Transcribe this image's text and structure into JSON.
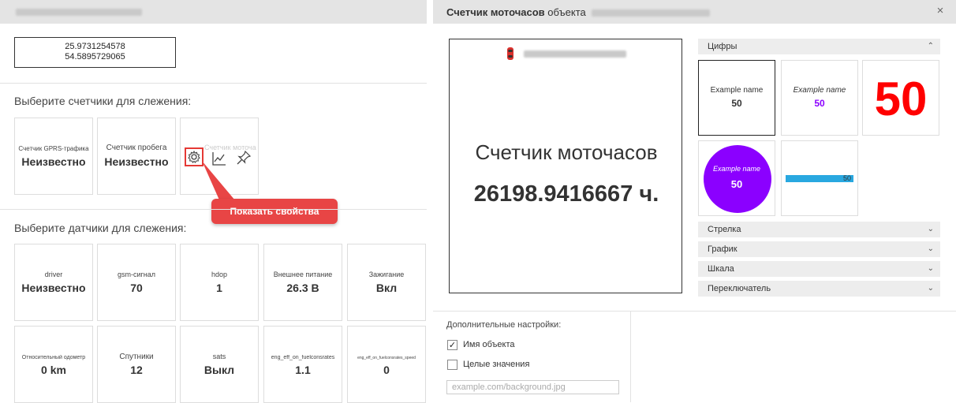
{
  "left": {
    "coords": {
      "lat": "25.9731254578",
      "lon": "54.5895729065"
    },
    "counters_title": "Выберите счетчики для слежения:",
    "counters": [
      {
        "label": "Счетчик GPRS-трафика",
        "value": "Неизвестно"
      },
      {
        "label": "Счетчик пробега",
        "value": "Неизвестно"
      },
      {
        "label": "Счетчик моточасов",
        "value": ""
      }
    ],
    "tooltip": "Показать свойства",
    "sensors_title": "Выберите датчики для слежения:",
    "sensors": [
      {
        "label": "driver",
        "value": "Неизвестно"
      },
      {
        "label": "gsm-сигнал",
        "value": "70"
      },
      {
        "label": "hdop",
        "value": "1"
      },
      {
        "label": "Внешнее питание",
        "value": "26.3 В"
      },
      {
        "label": "Зажигание",
        "value": "Вкл"
      },
      {
        "label": "Относительный одометр",
        "value": "0 km"
      },
      {
        "label": "Спутники",
        "value": "12"
      },
      {
        "label": "sats",
        "value": "Выкл"
      },
      {
        "label": "eng_eff_on_fuelconsrates",
        "value": "1.1"
      },
      {
        "label": "eng_eff_on_fuelconsrates_speed",
        "value": "0"
      }
    ]
  },
  "right": {
    "title_bold": "Счетчик моточасов",
    "title_rest": "объекта",
    "close": "×",
    "preview": {
      "title": "Счетчик моточасов",
      "value": "26198.9416667 ч."
    },
    "sections": {
      "digits": "Цифры",
      "arrow": "Стрелка",
      "graph": "График",
      "scale": "Шкала",
      "switch": "Переключатель"
    },
    "styles": {
      "name": "Example name",
      "value": "50",
      "purple": "#8b00ff",
      "red": "#ff0000"
    },
    "extra": {
      "title": "Дополнительные настройки:",
      "object_name": "Имя объекта",
      "integer_values": "Целые значения",
      "bg_placeholder": "example.com/background.jpg"
    }
  }
}
